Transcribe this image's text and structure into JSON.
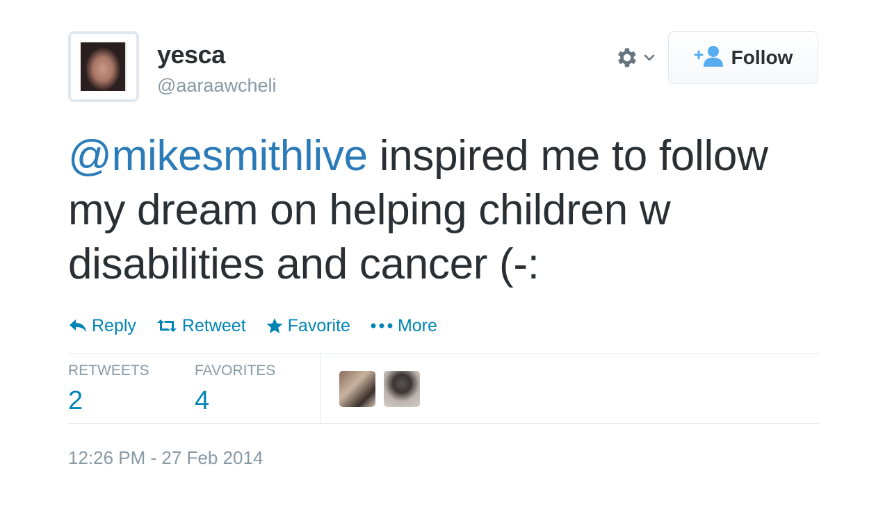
{
  "user": {
    "display_name": "yesca",
    "screen_name": "@aaraawcheli"
  },
  "follow_button": {
    "label": "Follow"
  },
  "tweet": {
    "mention": "@mikesmithlive",
    "text": " inspired me to follow my dream on helping children w disabilities and cancer (-:"
  },
  "actions": [
    {
      "label": "Reply",
      "icon": "reply-icon"
    },
    {
      "label": "Retweet",
      "icon": "retweet-icon"
    },
    {
      "label": "Favorite",
      "icon": "star-icon"
    },
    {
      "label": "More",
      "icon": "more-dots-icon"
    }
  ],
  "stats": {
    "retweets_label": "RETWEETS",
    "retweets_count": "2",
    "favorites_label": "FAVORITES",
    "favorites_count": "4"
  },
  "timestamp": "12:26 PM - 27 Feb 2014",
  "colors": {
    "link_blue": "#0084b4",
    "mention_blue": "#2b7bb9",
    "muted_gray": "#8899a6",
    "text_dark": "#292f33",
    "border": "#e1e8ed"
  }
}
